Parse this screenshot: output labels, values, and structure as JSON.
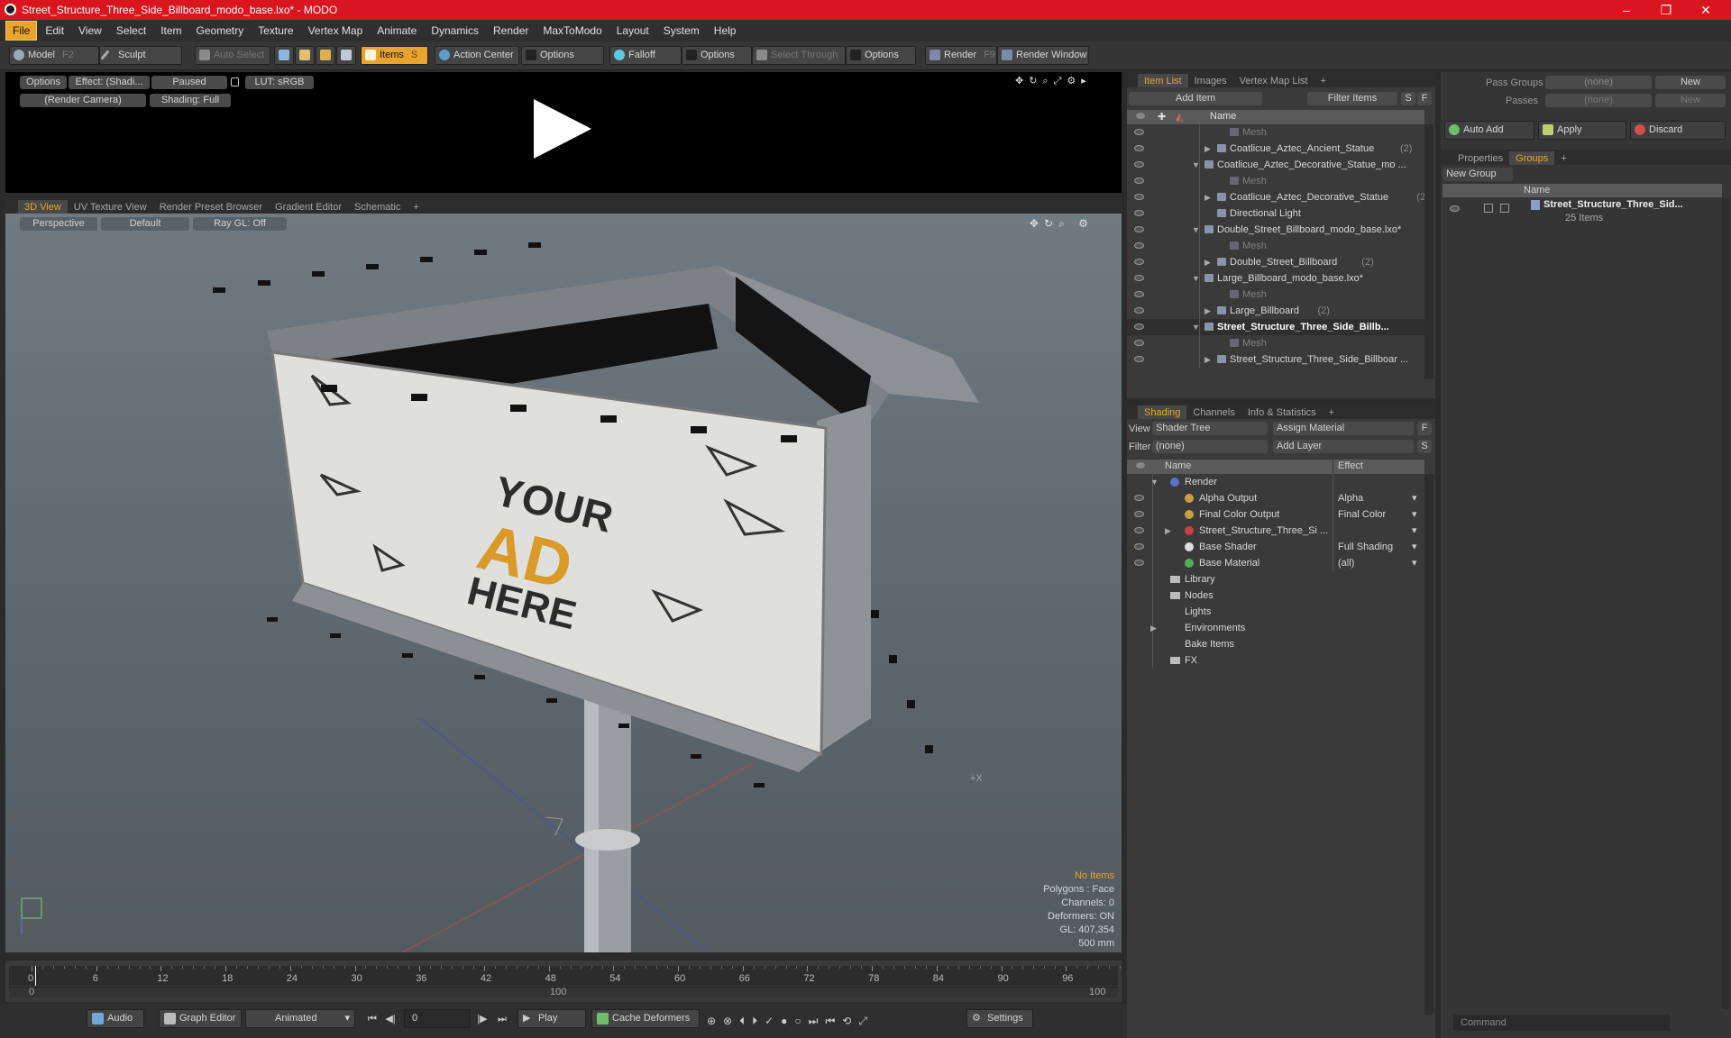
{
  "window": {
    "title": "Street_Structure_Three_Side_Billboard_modo_base.lxo* - MODO",
    "controls": [
      "–",
      "❐",
      "✕"
    ]
  },
  "menu": [
    "File",
    "Edit",
    "View",
    "Select",
    "Item",
    "Geometry",
    "Texture",
    "Vertex Map",
    "Animate",
    "Dynamics",
    "Render",
    "MaxToModo",
    "Layout",
    "System",
    "Help"
  ],
  "toolbar": {
    "model": "Model",
    "model_key": "F2",
    "sculpt": "Sculpt",
    "auto_select": "Auto Select",
    "items": "Items",
    "items_key": "S",
    "action_center": "Action Center",
    "options1": "Options",
    "falloff": "Falloff",
    "options2": "Options",
    "select_through": "Select Through",
    "options3": "Options",
    "render": "Render",
    "render_key": "F9",
    "render_window": "Render Window"
  },
  "preview": {
    "options": "Options",
    "effect": "Effect: (Shadi...",
    "paused": "Paused",
    "lut": "LUT: sRGB",
    "camera": "(Render Camera)",
    "shading": "Shading: Full"
  },
  "viewport_tabs": [
    "3D View",
    "UV Texture View",
    "Render Preset Browser",
    "Gradient Editor",
    "Schematic"
  ],
  "viewport": {
    "perspective": "Perspective",
    "default": "Default",
    "raygl": "Ray GL: Off",
    "corner_mark": "+X"
  },
  "billboard_ad": {
    "line1": "YOUR",
    "line2": "AD",
    "line3": "HERE"
  },
  "viewport_info": {
    "no_items": "No Items",
    "polygons": "Polygons : Face",
    "channels": "Channels: 0",
    "deformers": "Deformers: ON",
    "gl": "GL: 407,354",
    "size": "500 mm"
  },
  "timeline": {
    "ticks": [
      "0",
      "6",
      "12",
      "18",
      "24",
      "30",
      "36",
      "42",
      "48",
      "54",
      "60",
      "66",
      "72",
      "78",
      "84",
      "90",
      "96"
    ],
    "start": "0",
    "end": "100",
    "mid": "100"
  },
  "bottom": {
    "audio": "Audio",
    "graph_editor": "Graph Editor",
    "animated": "Animated",
    "frame": "0",
    "play": "Play",
    "cache": "Cache Deformers",
    "settings": "Settings"
  },
  "item_list": {
    "tabs": [
      "Item List",
      "Images",
      "Vertex Map List"
    ],
    "add_item": "Add Item",
    "filter": "Filter Items",
    "s": "S",
    "f": "F",
    "col_name": "Name",
    "rows": [
      {
        "label": "Mesh",
        "indent": 3,
        "dim": true,
        "tri": ""
      },
      {
        "label": "Coatlicue_Aztec_Ancient_Statue",
        "count": "(2)",
        "indent": 2,
        "tri": "▶"
      },
      {
        "label": "Coatlicue_Aztec_Decorative_Statue_mo ...",
        "indent": 1,
        "tri": "▼",
        "scene": true
      },
      {
        "label": "Mesh",
        "indent": 3,
        "dim": true,
        "tri": ""
      },
      {
        "label": "Coatlicue_Aztec_Decorative_Statue",
        "count": "(2)",
        "indent": 2,
        "tri": "▶"
      },
      {
        "label": "Directional Light",
        "indent": 2,
        "tri": ""
      },
      {
        "label": "Double_Street_Billboard_modo_base.lxo*",
        "indent": 1,
        "tri": "▼",
        "scene": true
      },
      {
        "label": "Mesh",
        "indent": 3,
        "dim": true,
        "tri": ""
      },
      {
        "label": "Double_Street_Billboard",
        "count": "(2)",
        "indent": 2,
        "tri": "▶"
      },
      {
        "label": "Large_Billboard_modo_base.lxo*",
        "indent": 1,
        "tri": "▼",
        "scene": true
      },
      {
        "label": "Mesh",
        "indent": 3,
        "dim": true,
        "tri": ""
      },
      {
        "label": "Large_Billboard",
        "count": "(2)",
        "indent": 2,
        "tri": "▶"
      },
      {
        "label": "Street_Structure_Three_Side_Billb...",
        "indent": 1,
        "tri": "▼",
        "scene": true,
        "bold": true
      },
      {
        "label": "Mesh",
        "indent": 3,
        "dim": true,
        "tri": ""
      },
      {
        "label": "Street_Structure_Three_Side_Billboar ...",
        "indent": 2,
        "tri": "▶"
      }
    ]
  },
  "shading": {
    "tabs": [
      "Shading",
      "Channels",
      "Info & Statistics"
    ],
    "view_label": "View",
    "view_value": "Shader Tree",
    "assign": "Assign Material",
    "f": "F",
    "filter_label": "Filter",
    "filter_value": "(none)",
    "add_layer": "Add Layer",
    "s": "S",
    "col_name": "Name",
    "col_effect": "Effect",
    "rows": [
      {
        "label": "Render",
        "effect": "",
        "indent": 0,
        "tri": "▼",
        "color": "#5a6fd0",
        "eye": false
      },
      {
        "label": "Alpha Output",
        "effect": "Alpha",
        "indent": 1,
        "color": "#c8a040",
        "eye": true
      },
      {
        "label": "Final Color Output",
        "effect": "Final Color",
        "indent": 1,
        "color": "#c8a040",
        "eye": true
      },
      {
        "label": "Street_Structure_Three_Si ...",
        "effect": "",
        "indent": 1,
        "tri": "▶",
        "color": "#c84040",
        "eye": true
      },
      {
        "label": "Base Shader",
        "effect": "Full Shading",
        "indent": 1,
        "color": "#dddddd",
        "eye": true
      },
      {
        "label": "Base Material",
        "effect": "(all)",
        "indent": 1,
        "color": "#50b050",
        "eye": true
      },
      {
        "label": "Library",
        "effect": "",
        "indent": 0,
        "color": "",
        "folder": true
      },
      {
        "label": "Nodes",
        "effect": "",
        "indent": 0,
        "color": "",
        "folder": true
      },
      {
        "label": "Lights",
        "effect": "",
        "indent": 0,
        "color": ""
      },
      {
        "label": "Environments",
        "effect": "",
        "indent": 0,
        "tri": "▶",
        "color": ""
      },
      {
        "label": "Bake Items",
        "effect": "",
        "indent": 0,
        "color": ""
      },
      {
        "label": "FX",
        "effect": "",
        "indent": 0,
        "color": "",
        "folder": true
      }
    ]
  },
  "right_panel": {
    "pass_groups_label": "Pass Groups",
    "pass_groups_value": "(none)",
    "new": "New",
    "passes_label": "Passes",
    "passes_value": "(none)",
    "new2": "New",
    "auto_add": "Auto Add",
    "apply": "Apply",
    "discard": "Discard",
    "tabs": [
      "Properties",
      "Groups"
    ],
    "new_group": "New Group",
    "col_name": "Name",
    "group_name": "Street_Structure_Three_Sid...",
    "group_items": "25 Items"
  },
  "command": {
    "placeholder": "Command"
  },
  "colors": {
    "accent": "#e8a42c",
    "titlebar": "#d9161f",
    "panel": "#3a3a3a",
    "viewport_bg": "#5f6870"
  }
}
